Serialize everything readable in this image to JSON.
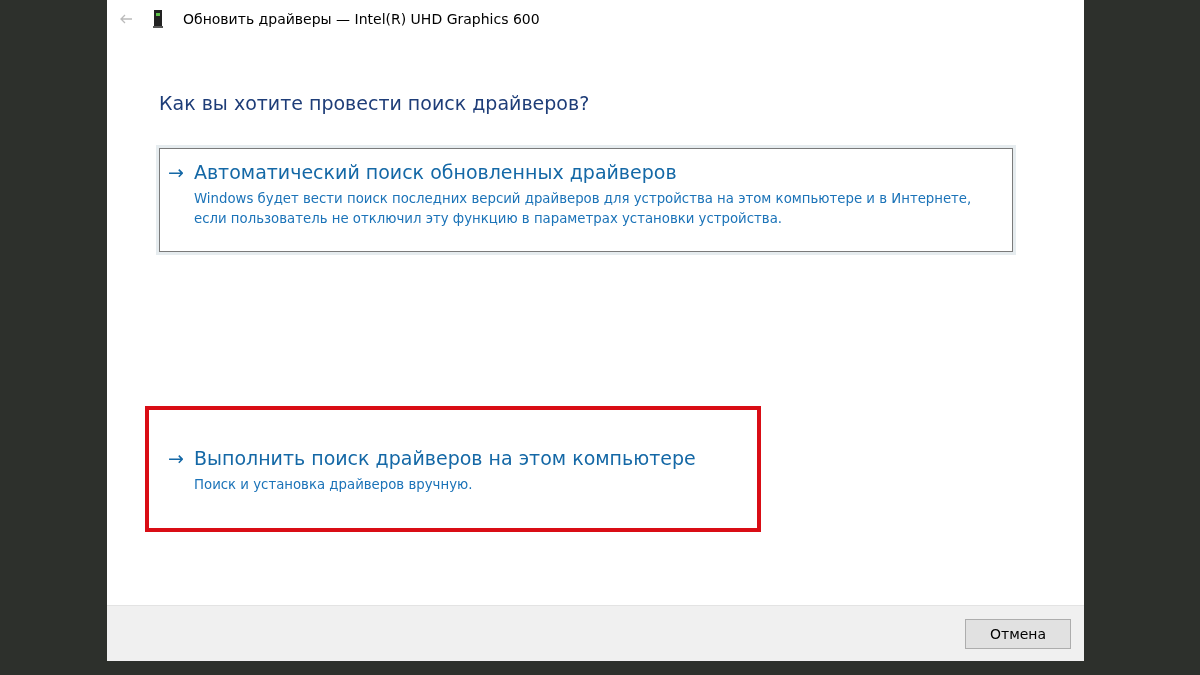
{
  "window": {
    "title": "Обновить драйверы — Intel(R) UHD Graphics 600"
  },
  "heading": "Как вы хотите провести поиск драйверов?",
  "options": [
    {
      "arrow": "→",
      "title": "Автоматический поиск обновленных драйверов",
      "description": "Windows будет вести поиск последних версий драйверов для устройства на этом компьютере и в Интернете, если пользователь не отключил эту функцию в параметрах установки устройства.",
      "focused": true,
      "highlighted": false
    },
    {
      "arrow": "→",
      "title": "Выполнить поиск драйверов на этом компьютере",
      "description": "Поиск и установка драйверов вручную.",
      "focused": false,
      "highlighted": true
    }
  ],
  "buttons": [
    "Отмена"
  ]
}
